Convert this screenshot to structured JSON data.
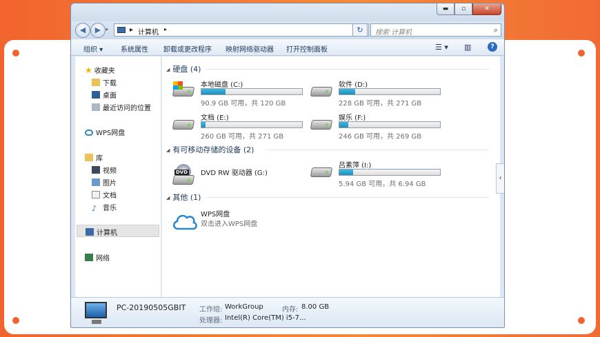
{
  "window": {
    "minimize": "▬",
    "maximize": "▫",
    "close": "✕"
  },
  "address": {
    "crumbs": [
      "计算机"
    ],
    "separator": "▸",
    "refresh": "↻",
    "search_placeholder": "搜索 计算机",
    "back": "◀",
    "forward": "▶"
  },
  "toolbar": {
    "organize": "组织 ▾",
    "system_props": "系统属性",
    "uninstall": "卸载或更改程序",
    "map_drive": "映射网络驱动器",
    "control_panel": "打开控制面板",
    "view_icon": "☰ ▾",
    "pane_icon": "▥",
    "help": "?"
  },
  "nav": {
    "favorites": "收藏夹",
    "downloads": "下载",
    "desktop": "桌面",
    "recent": "最近访问的位置",
    "wps_cloud": "WPS网盘",
    "libraries": "库",
    "videos": "视频",
    "pictures": "图片",
    "documents": "文档",
    "music": "音乐",
    "computer": "计算机",
    "network": "网络"
  },
  "groups": {
    "hdd": "硬盘 (4)",
    "removable": "有可移动存储的设备 (2)",
    "other": "其他 (1)"
  },
  "drives": [
    {
      "name": "本地磁盘 (C:)",
      "free": "90.9 GB 可用，共 120 GB",
      "used_fraction": 0.24
    },
    {
      "name": "软件 (D:)",
      "free": "228 GB 可用，共 271 GB",
      "used_fraction": 0.16
    },
    {
      "name": "文档 (E:)",
      "free": "260 GB 可用，共 271 GB",
      "used_fraction": 0.04
    },
    {
      "name": "娱乐 (F:)",
      "free": "246 GB 可用，共 269 GB",
      "used_fraction": 0.09
    }
  ],
  "removable": [
    {
      "name": "DVD RW 驱动器 (G:)"
    },
    {
      "name": "吕素萍 (I:)",
      "free": "5.94 GB 可用，共 6.94 GB",
      "used_fraction": 0.14
    }
  ],
  "other": {
    "name": "WPS网盘",
    "desc": "双击进入WPS网盘"
  },
  "details": {
    "pc_name": "PC-20190505GBIT",
    "workgroup_label": "工作组:",
    "workgroup": "WorkGroup",
    "memory_label": "内存:",
    "memory": "8.00 GB",
    "cpu_label": "处理器:",
    "cpu": "Intel(R) Core(TM) i5-7..."
  },
  "colors": {
    "accent_orange": "#f2642d",
    "bar_fill": "#1f8fbd",
    "link_blue": "#1e395b"
  }
}
